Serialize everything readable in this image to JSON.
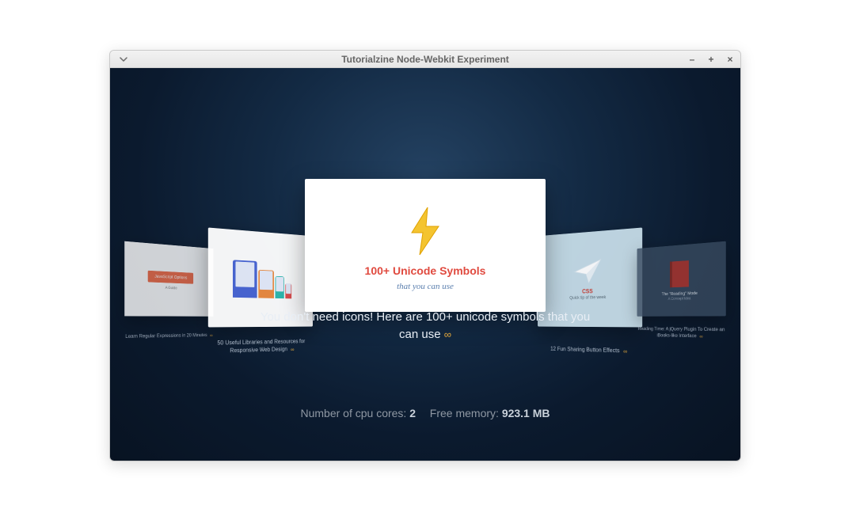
{
  "window": {
    "title": "Tutorialzine Node-Webkit Experiment"
  },
  "controls": {
    "minimize": "–",
    "maximize": "+",
    "close": "×"
  },
  "carousel": {
    "items": [
      {
        "headline": "JavaScript Options",
        "sub": "A Guide",
        "caption_line1": "Learn Regular Expressions in 20 Minutes",
        "link_text": ""
      },
      {
        "headline": "",
        "sub": "",
        "caption_line1": "50 Useful Libraries and Resources for",
        "caption_line2": "Responsive Web Design",
        "link_text": ""
      },
      {
        "headline": "100+ Unicode Symbols",
        "sub": "that you can use"
      },
      {
        "headline": "CSS",
        "sub": "Quick tip of the week",
        "caption_line1": "12 Fun Sharing Button Effects",
        "link_text": ""
      },
      {
        "headline": "The \"Reading\" Mode",
        "sub": "A Concept Idea",
        "caption_line1": "Reading Time: A jQuery Plugin To Create an",
        "caption_line2": "iBooks-like Interface",
        "link_text": ""
      }
    ],
    "description": "You don't need icons! Here are 100+ unicode symbols that you can use",
    "description_link": "∞"
  },
  "stats": {
    "cpu_label": "Number of cpu cores:",
    "cpu_value": "2",
    "mem_label": "Free memory:",
    "mem_value": "923.1 MB"
  }
}
